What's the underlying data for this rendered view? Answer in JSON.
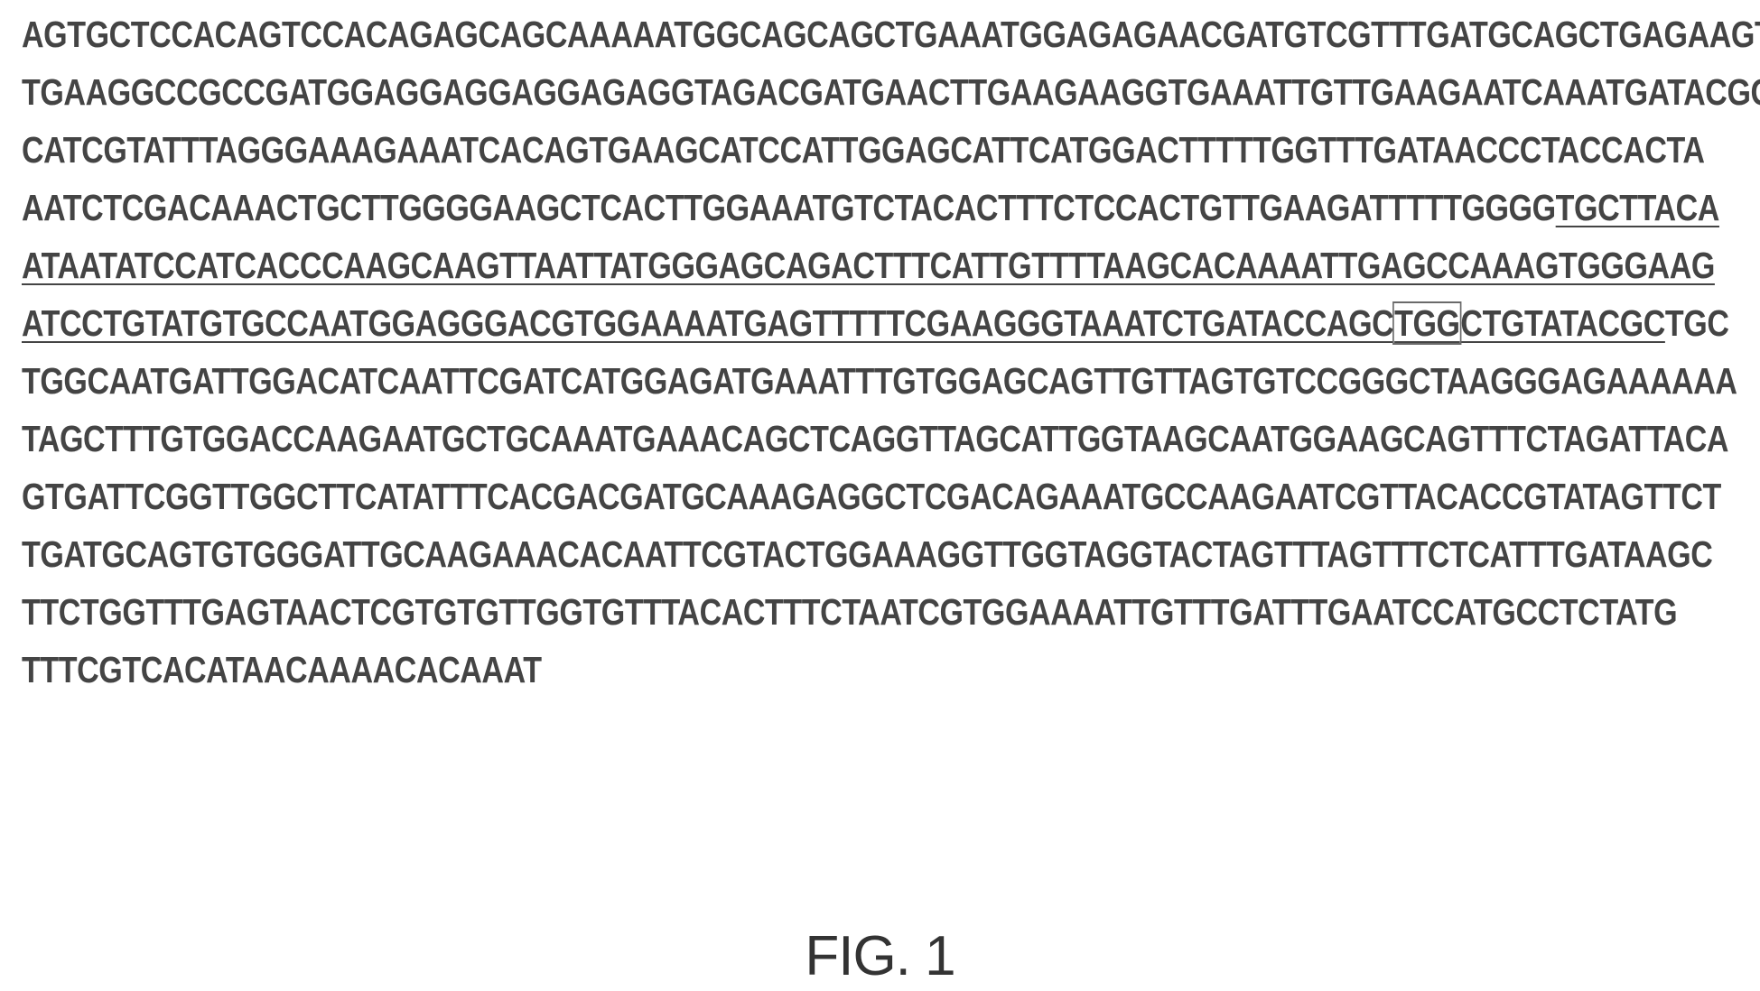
{
  "figure": {
    "caption": "FIG. 1",
    "colors": {
      "text": "#444444",
      "box_outline": "#6a6a6a",
      "background": "#ffffff"
    },
    "lines": [
      {
        "segments": [
          {
            "text": "AGTGCTCCACAGTCCACAGAGCAGCAAAAATGGCAGCAGCTGAAATGGAGAGAACGATGTCGTTTGATGCAGCTGAGAAGT",
            "style": "plain"
          }
        ]
      },
      {
        "segments": [
          {
            "text": "TGAAGGCCGCCGATGGAGGAGGAGGAGAGGTAGACGATGAACTTGAAGAAGGTGAAATTGTTGAAGAATCAAATGATACGG",
            "style": "plain"
          }
        ]
      },
      {
        "segments": [
          {
            "text": "CATCGTATTTAGGGAAAGAAATCACAGTGAAGCATCCATTGGAGCATTCATGGACTTTTTGGTTTGATAACCCTACCACTA",
            "style": "plain"
          }
        ]
      },
      {
        "segments": [
          {
            "text": "AATCTCGACAAACTGCTTGGGGAAGCTCACTTGGAAATGTCTACACTTTCTCCACTGTTGAAGATTTTTGGGG",
            "style": "plain"
          },
          {
            "text": "TGCTTACA",
            "style": "underline"
          }
        ]
      },
      {
        "segments": [
          {
            "text": "ATAATATCCATCACCCAAGCAAGTTAATTATGGGAGCAGACTTTCATTGTTTTAAGCACAAAATTGAGCCAAAGTGGGAAG",
            "style": "underline"
          }
        ]
      },
      {
        "segments": [
          {
            "text": "ATCCTGTATGTGCCAATGGAGGGACGTGGAAAATGAGTTTTTCGAAGGGTAAATCTGATACCAGC",
            "style": "underline"
          },
          {
            "text": "TGG",
            "style": "boxed"
          },
          {
            "text": "CTGTATACGC",
            "style": "underline"
          },
          {
            "text": "TGC",
            "style": "plain"
          }
        ]
      },
      {
        "segments": [
          {
            "text": "TGGCAATGATTGGACATCAATTCGATCATGGAGATGAAATTTGTGGAGCAGTTGTTAGTGTCCGGGCTAAGGGAGAAAAAA",
            "style": "plain"
          }
        ]
      },
      {
        "segments": [
          {
            "text": "TAGCTTTGTGGACCAAGAATGCTGCAAATGAAACAGCTCAGGTTAGCATTGGTAAGCAATGGAAGCAGTTTCTAGATTACA",
            "style": "plain"
          }
        ]
      },
      {
        "segments": [
          {
            "text": "GTGATTCGGTTGGCTTCATATTTCACGACGATGCAAAGAGGCTCGACAGAAATGCCAAGAATCGTTACACCGTATAGTTCT",
            "style": "plain"
          }
        ]
      },
      {
        "segments": [
          {
            "text": "TGATGCAGTGTGGGATTGCAAGAAACACAATTCGTACTGGAAAGGTTGGTAGGTACTAGTTTAGTTTCTCATTTGATAAGC",
            "style": "plain"
          }
        ]
      },
      {
        "segments": [
          {
            "text": "TTCTGGTTTGAGTAACTCGTGTGTTGGTGTTTACACTTTCTAATCGTGGAAAATTGTTTGATTTGAATCCATGCCTCTATG",
            "style": "plain"
          }
        ]
      },
      {
        "segments": [
          {
            "text": "TTTCGTCACATAACAAAACACAAAT",
            "style": "plain"
          }
        ]
      }
    ]
  }
}
